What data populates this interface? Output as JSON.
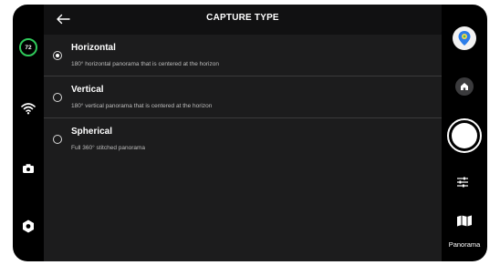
{
  "status": {
    "battery_level": "72"
  },
  "header": {
    "title": "CAPTURE TYPE"
  },
  "options": [
    {
      "title": "Horizontal",
      "description": "180° horizontal panorama that is centered at the horizon",
      "selected": true
    },
    {
      "title": "Vertical",
      "description": "180° vertical panorama that is centered at the horizon",
      "selected": false
    },
    {
      "title": "Spherical",
      "description": "Full 360° stitched panorama",
      "selected": false
    }
  ],
  "right_rail": {
    "mode_label": "Panorama"
  },
  "icons": {
    "battery": "battery-ring-icon",
    "wifi": "wifi-icon",
    "camera": "camera-icon",
    "settings": "gear-icon",
    "back": "arrow-left-icon",
    "avatar": "map-pin-avatar-icon",
    "home": "home-icon",
    "shutter": "shutter-button",
    "adjust": "sliders-icon",
    "mode": "panorama-icon"
  },
  "colors": {
    "battery_ring": "#2fc85a",
    "panel": "#1c1c1d",
    "header": "#111112",
    "avatar_accent": "#2b7de9"
  }
}
